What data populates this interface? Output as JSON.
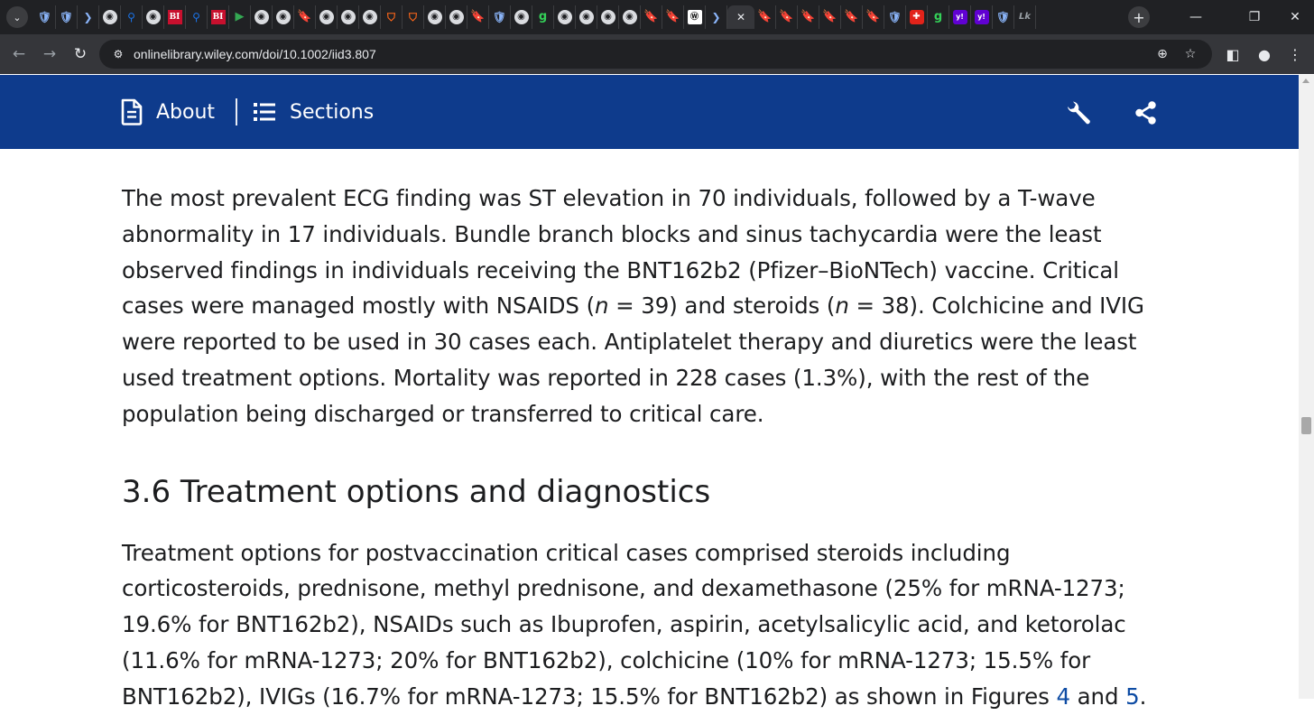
{
  "browser": {
    "tabs": [
      {
        "icon": "shield-icon",
        "glyph": "🛡"
      },
      {
        "icon": "shield-icon",
        "glyph": "🛡"
      },
      {
        "icon": "chevron-icon",
        "glyph": "❯"
      },
      {
        "icon": "globe-icon",
        "glyph": "◉"
      },
      {
        "icon": "search-icon",
        "glyph": "⚲"
      },
      {
        "icon": "globe-icon",
        "glyph": "◉"
      },
      {
        "icon": "business-insider-icon",
        "glyph": "BI"
      },
      {
        "icon": "search-icon",
        "glyph": "⚲"
      },
      {
        "icon": "business-insider-icon",
        "glyph": "BI"
      },
      {
        "icon": "play-icon",
        "glyph": "▶"
      },
      {
        "icon": "globe-icon",
        "glyph": "◉"
      },
      {
        "icon": "globe-icon",
        "glyph": "◉"
      },
      {
        "icon": "bookmark-icon",
        "glyph": "🔖"
      },
      {
        "icon": "globe-icon",
        "glyph": "◉"
      },
      {
        "icon": "globe-icon",
        "glyph": "◉"
      },
      {
        "icon": "globe-icon",
        "glyph": "◉"
      },
      {
        "icon": "shield-outline-icon",
        "glyph": "⛉"
      },
      {
        "icon": "shield-outline-icon",
        "glyph": "⛉"
      },
      {
        "icon": "globe-icon",
        "glyph": "◉"
      },
      {
        "icon": "globe-icon",
        "glyph": "◉"
      },
      {
        "icon": "bookmark-icon",
        "glyph": "🔖"
      },
      {
        "icon": "shield-icon",
        "glyph": "🛡"
      },
      {
        "icon": "globe-icon",
        "glyph": "◉"
      },
      {
        "icon": "green-g-icon",
        "glyph": "g"
      },
      {
        "icon": "globe-icon",
        "glyph": "◉"
      },
      {
        "icon": "globe-icon",
        "glyph": "◉"
      },
      {
        "icon": "globe-icon",
        "glyph": "◉"
      },
      {
        "icon": "globe-icon",
        "glyph": "◉"
      },
      {
        "icon": "bookmark-icon",
        "glyph": "🔖"
      },
      {
        "icon": "bookmark-icon",
        "glyph": "🔖"
      },
      {
        "icon": "wiley-icon",
        "glyph": "Ⓦ"
      },
      {
        "icon": "chevron-icon",
        "glyph": "❯"
      },
      {
        "icon": "close-icon",
        "glyph": "✕",
        "active": true
      },
      {
        "icon": "bookmark-icon",
        "glyph": "🔖"
      },
      {
        "icon": "bookmark-icon",
        "glyph": "🔖"
      },
      {
        "icon": "bookmark-icon",
        "glyph": "🔖"
      },
      {
        "icon": "bookmark-icon",
        "glyph": "🔖"
      },
      {
        "icon": "bookmark-icon",
        "glyph": "🔖"
      },
      {
        "icon": "bookmark-icon",
        "glyph": "🔖"
      },
      {
        "icon": "shield-icon",
        "glyph": "🛡"
      },
      {
        "icon": "red-app-icon",
        "glyph": "✚"
      },
      {
        "icon": "green-g-icon",
        "glyph": "g"
      },
      {
        "icon": "yahoo-icon",
        "glyph": "y!"
      },
      {
        "icon": "yahoo-icon",
        "glyph": "y!"
      },
      {
        "icon": "shield-icon",
        "glyph": "🛡"
      },
      {
        "icon": "text-icon",
        "glyph": "Lk"
      }
    ],
    "new_tab_glyph": "+",
    "tab_menu_glyph": "⌄",
    "window_controls": {
      "minimize": "—",
      "restore": "❐",
      "close": "✕"
    },
    "nav": {
      "back": "←",
      "forward": "→",
      "reload": "↻"
    },
    "url": "onlinelibrary.wiley.com/doi/10.1002/iid3.807",
    "site_info_glyph": "⚙",
    "zoom_glyph": "⊕",
    "star_glyph": "☆",
    "sidepanel_glyph": "◧",
    "profile_glyph": "●",
    "menu_glyph": "⋮"
  },
  "header": {
    "about_label": "About",
    "sections_label": "Sections",
    "background": "#0e3b8c"
  },
  "article": {
    "para1": [
      {
        "t": "The most prevalent ECG finding was ST elevation in 70 individuals, followed by a T-wave abnormality in 17 individuals. Bundle branch blocks and sinus tachycardia were the least observed findings in individuals receiving the BNT162b2 (Pfizer–BioNTech) vaccine. Critical cases were managed mostly with NSAIDS ("
      },
      {
        "t": "n",
        "i": true
      },
      {
        "t": " = 39) and steroids ("
      },
      {
        "t": "n",
        "i": true
      },
      {
        "t": " = 38). Colchicine and IVIG were reported to be used in 30 cases each. Antiplatelet therapy and diuretics were the least used treatment options. Mortality was reported in 228 cases (1.3%), with the rest of the population being discharged or transferred to critical care."
      }
    ],
    "heading": "3.6 Treatment options and diagnostics",
    "para2": [
      {
        "t": "Treatment options for postvaccination critical cases comprised steroids including corticosteroids, prednisone, methyl prednisone, and dexamethasone (25% for mRNA-1273; 19.6% for BNT162b2), NSAIDs such as Ibuprofen, aspirin, acetylsalicylic acid, and ketorolac (11.6% for mRNA-1273; 20% for BNT162b2), colchicine (10% for mRNA-1273; 15.5% for BNT162b2), IVIGs (16.7% for mRNA-1273; 15.5% for BNT162b2) as shown in Figures "
      },
      {
        "t": "4",
        "link": true
      },
      {
        "t": " and "
      },
      {
        "t": "5",
        "link": true
      },
      {
        "t": "."
      }
    ]
  }
}
